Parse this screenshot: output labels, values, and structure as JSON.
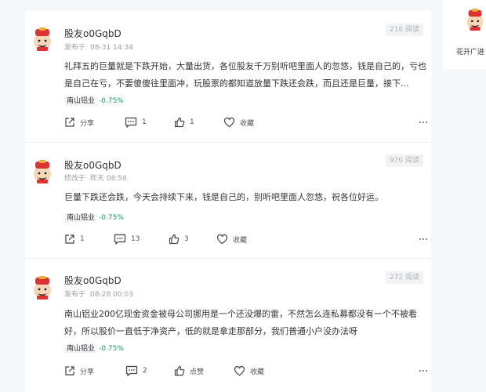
{
  "posts": [
    {
      "username": "股友o0GqbD",
      "meta_prefix": "发布于",
      "meta_time": "08-31 14:34",
      "views": "216 阅读",
      "content": "礼拜五的巨量就是下跌开始，大量出货，各位股友千万别听吧里面人的忽悠，钱是自己的，亏也是自己在亏，不要傻傻往里面冲，玩股票的都知道放量下跌还会跌，而且还是巨量，接下...",
      "tag_name": "南山铝业",
      "tag_change": "-0.75%",
      "share": "分享",
      "comments": "1",
      "likes": "1",
      "favorite": "收藏"
    },
    {
      "username": "股友o0GqbD",
      "meta_prefix": "修改于",
      "meta_time": "昨天 08:58",
      "views": "970 阅读",
      "content": "巨量下跌还会跌，今天会持续下来，钱是自己的，别听吧里面人忽悠，祝各位好运。",
      "tag_name": "南山铝业",
      "tag_change": "-0.75%",
      "share": "1",
      "comments": "13",
      "likes": "3",
      "favorite": "收藏"
    },
    {
      "username": "股友o0GqbD",
      "meta_prefix": "发布于",
      "meta_time": "08-28 00:03",
      "views": "272 阅读",
      "content": "南山铝业200亿现金资金被母公司挪用是一个还没爆的雷，不然怎么连私募都没有一个不被看好，所以股价一直低于净资产，低的就是拿走那部分，我们普通小户没办法呀",
      "tag_name": "南山铝业",
      "tag_change": "-0.75%",
      "share": "分享",
      "comments": "2",
      "likes": "点赞",
      "favorite": "收藏"
    }
  ],
  "sidebar": {
    "name": "花开广进"
  },
  "colors": {
    "up_down": "#1aa061",
    "muted": "#9aa0a6"
  }
}
